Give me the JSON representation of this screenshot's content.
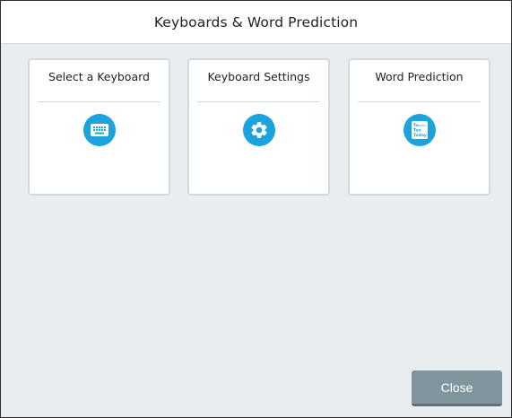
{
  "window": {
    "title": "Keyboards & Word Prediction"
  },
  "cards": [
    {
      "label": "Select a Keyboard",
      "icon": "keyboard-icon"
    },
    {
      "label": "Keyboard Settings",
      "icon": "gear-icon"
    },
    {
      "label": "Word Prediction",
      "icon": "word-prediction-icon",
      "icon_text": [
        "To",
        "Too",
        "Today"
      ]
    }
  ],
  "footer": {
    "close_label": "Close"
  },
  "colors": {
    "accent": "#1aa3dd",
    "background": "#e9edf0",
    "button": "#80959e"
  }
}
